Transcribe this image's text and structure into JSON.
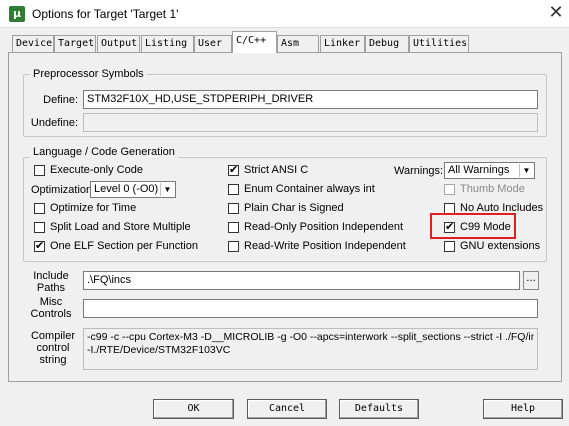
{
  "window": {
    "title": "Options for Target 'Target 1'",
    "app_icon": "µ"
  },
  "tabs": [
    "Device",
    "Target",
    "Output",
    "Listing",
    "User",
    "C/C++",
    "Asm",
    "Linker",
    "Debug",
    "Utilities"
  ],
  "active_tab": "C/C++",
  "preprocessor": {
    "group_label": "Preprocessor Symbols",
    "define_label": "Define:",
    "define_value": "STM32F10X_HD,USE_STDPERIPH_DRIVER",
    "undefine_label": "Undefine:",
    "undefine_value": ""
  },
  "language": {
    "group_label": "Language / Code Generation",
    "execute_only": {
      "label": "Execute-only Code",
      "checked": false
    },
    "optimization_label": "Optimization:",
    "optimization_value": "Level 0 (-O0)",
    "optimize_for_time": {
      "label": "Optimize for Time",
      "checked": false
    },
    "split_load_store": {
      "label": "Split Load and Store Multiple",
      "checked": false
    },
    "one_elf_section": {
      "label": "One ELF Section per Function",
      "checked": true
    },
    "strict_ansi": {
      "label": "Strict ANSI C",
      "checked": true
    },
    "enum_container": {
      "label": "Enum Container always int",
      "checked": false
    },
    "plain_char_signed": {
      "label": "Plain Char is Signed",
      "checked": false
    },
    "ro_position_independent": {
      "label": "Read-Only Position Independent",
      "checked": false
    },
    "rw_position_independent": {
      "label": "Read-Write Position Independent",
      "checked": false
    },
    "warnings_label": "Warnings:",
    "warnings_value": "All Warnings",
    "thumb_mode": {
      "label": "Thumb Mode",
      "checked": false
    },
    "no_auto_includes": {
      "label": "No Auto Includes",
      "checked": false
    },
    "c99_mode": {
      "label": "C99 Mode",
      "checked": true
    },
    "gnu_extensions": {
      "label": "GNU extensions",
      "checked": false
    }
  },
  "include_paths": {
    "label_line1": "Include",
    "label_line2": "Paths",
    "value": ".\\FQ\\incs",
    "browse": "..."
  },
  "misc_controls": {
    "label_line1": "Misc",
    "label_line2": "Controls",
    "value": ""
  },
  "compiler_string": {
    "label_line1": "Compiler",
    "label_line2": "control",
    "label_line3": "string",
    "line1": "-c99 -c --cpu Cortex-M3 -D__MICROLIB -g -O0 --apcs=interwork --split_sections --strict -I ./FQ/incs",
    "line2": "-I./RTE/Device/STM32F103VC"
  },
  "buttons": {
    "ok": "OK",
    "cancel": "Cancel",
    "defaults": "Defaults",
    "help": "Help"
  },
  "check_mark": "✔",
  "colors": {
    "highlight": "#e02020",
    "title_bg": "#ffffff",
    "dialog_bg": "#f0f0f0"
  }
}
